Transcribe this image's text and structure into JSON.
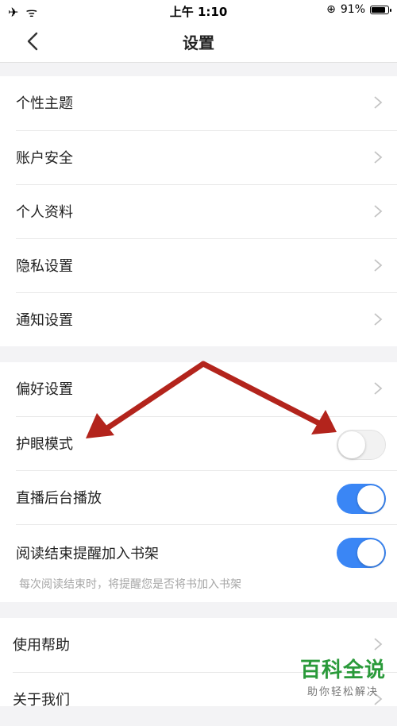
{
  "status": {
    "time": "上午 1:10",
    "battery": "91%",
    "battery_level": 0.91
  },
  "nav": {
    "title": "设置"
  },
  "groups": [
    {
      "items": [
        {
          "label": "个性主题"
        },
        {
          "label": "账户安全"
        },
        {
          "label": "个人资料"
        },
        {
          "label": "隐私设置"
        },
        {
          "label": "通知设置"
        }
      ]
    },
    {
      "items": [
        {
          "label": "偏好设置"
        },
        {
          "label": "护眼模式",
          "toggle": false
        },
        {
          "label": "直播后台播放",
          "toggle": true
        },
        {
          "label": "阅读结束提醒加入书架",
          "toggle": true,
          "desc": "每次阅读结束时，将提醒您是否将书加入书架"
        }
      ]
    },
    {
      "items": [
        {
          "label": "使用帮助"
        },
        {
          "label": "关于我们"
        }
      ]
    }
  ],
  "watermark": {
    "title": "百科全说",
    "subtitle": "助你轻松解决"
  },
  "colors": {
    "accent": "#3a86f5",
    "arrow": "#b3241c",
    "watermark": "#2a9a3a"
  }
}
